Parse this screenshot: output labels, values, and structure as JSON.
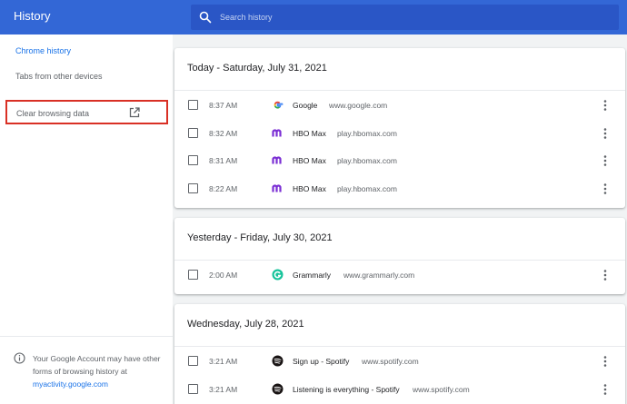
{
  "header": {
    "title": "History",
    "search_placeholder": "Search history"
  },
  "sidebar": {
    "items": [
      {
        "label": "Chrome history",
        "active": true
      },
      {
        "label": "Tabs from other devices",
        "active": false
      }
    ],
    "clear_label": "Clear browsing data",
    "footer_text": "Your Google Account may have other forms of browsing history at",
    "footer_link": "myactivity.google.com"
  },
  "groups": [
    {
      "title": "Today - Saturday, July 31, 2021",
      "rows": [
        {
          "time": "8:37 AM",
          "title": "Google",
          "domain": "www.google.com",
          "icon": "google-icon"
        },
        {
          "time": "8:32 AM",
          "title": "HBO Max",
          "domain": "play.hbomax.com",
          "icon": "hbomax-icon"
        },
        {
          "time": "8:31 AM",
          "title": "HBO Max",
          "domain": "play.hbomax.com",
          "icon": "hbomax-icon"
        },
        {
          "time": "8:22 AM",
          "title": "HBO Max",
          "domain": "play.hbomax.com",
          "icon": "hbomax-icon"
        }
      ]
    },
    {
      "title": "Yesterday - Friday, July 30, 2021",
      "rows": [
        {
          "time": "2:00 AM",
          "title": "Grammarly",
          "domain": "www.grammarly.com",
          "icon": "grammarly-icon"
        }
      ]
    },
    {
      "title": "Wednesday, July 28, 2021",
      "rows": [
        {
          "time": "3:21 AM",
          "title": "Sign up - Spotify",
          "domain": "www.spotify.com",
          "icon": "spotify-icon"
        },
        {
          "time": "3:21 AM",
          "title": "Listening is everything - Spotify",
          "domain": "www.spotify.com",
          "icon": "spotify-icon"
        }
      ]
    }
  ],
  "colors": {
    "header": "#3367d6",
    "accent": "#1a73e8",
    "highlight_box": "#d93025",
    "hbomax": "#7b2fd4",
    "grammarly": "#15c39a",
    "spotify": "#191414"
  }
}
